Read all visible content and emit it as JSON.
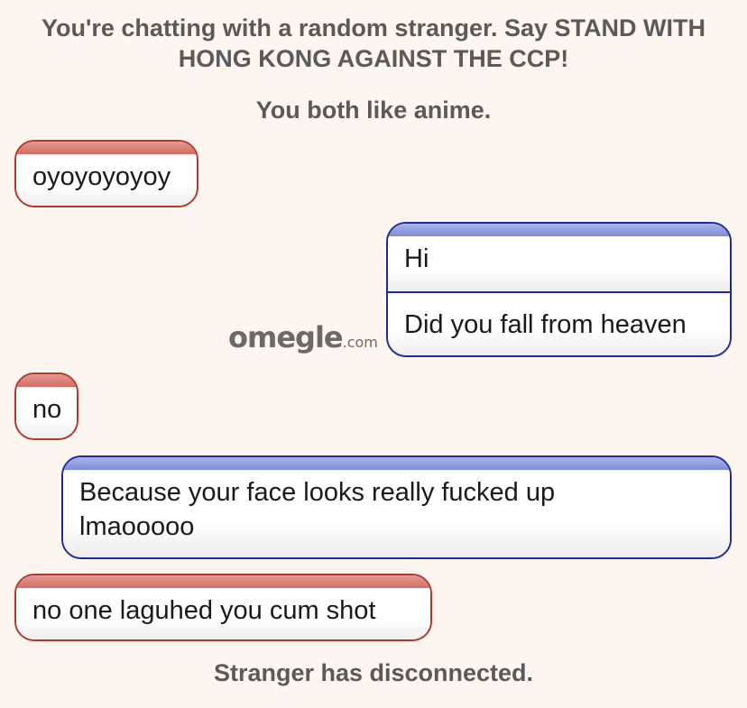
{
  "header": {
    "intro_line1": "You're chatting with a random stranger. Say STAND WITH",
    "intro_line2": "HONG KONG AGAINST THE CCP!",
    "common_interest": "You both like anime."
  },
  "logo": {
    "name": "omegle",
    "suffix": ".com"
  },
  "messages": [
    {
      "sender": "stranger",
      "lines": [
        "oyoyoyoyoy"
      ]
    },
    {
      "sender": "you",
      "lines": [
        "Hi",
        "Did you fall from heaven"
      ]
    },
    {
      "sender": "stranger",
      "lines": [
        "no"
      ]
    },
    {
      "sender": "you",
      "lines": [
        "Because your face looks really fucked up",
        "lmaooooo"
      ]
    },
    {
      "sender": "stranger",
      "lines": [
        "no one laguhed you cum shot"
      ]
    }
  ],
  "footer": {
    "status": "Stranger has disconnected."
  },
  "colors": {
    "background": "#fdf5ef",
    "stranger_border": "#b5372c",
    "you_border": "#1f2a9e",
    "system_text": "#5a5a5a"
  }
}
